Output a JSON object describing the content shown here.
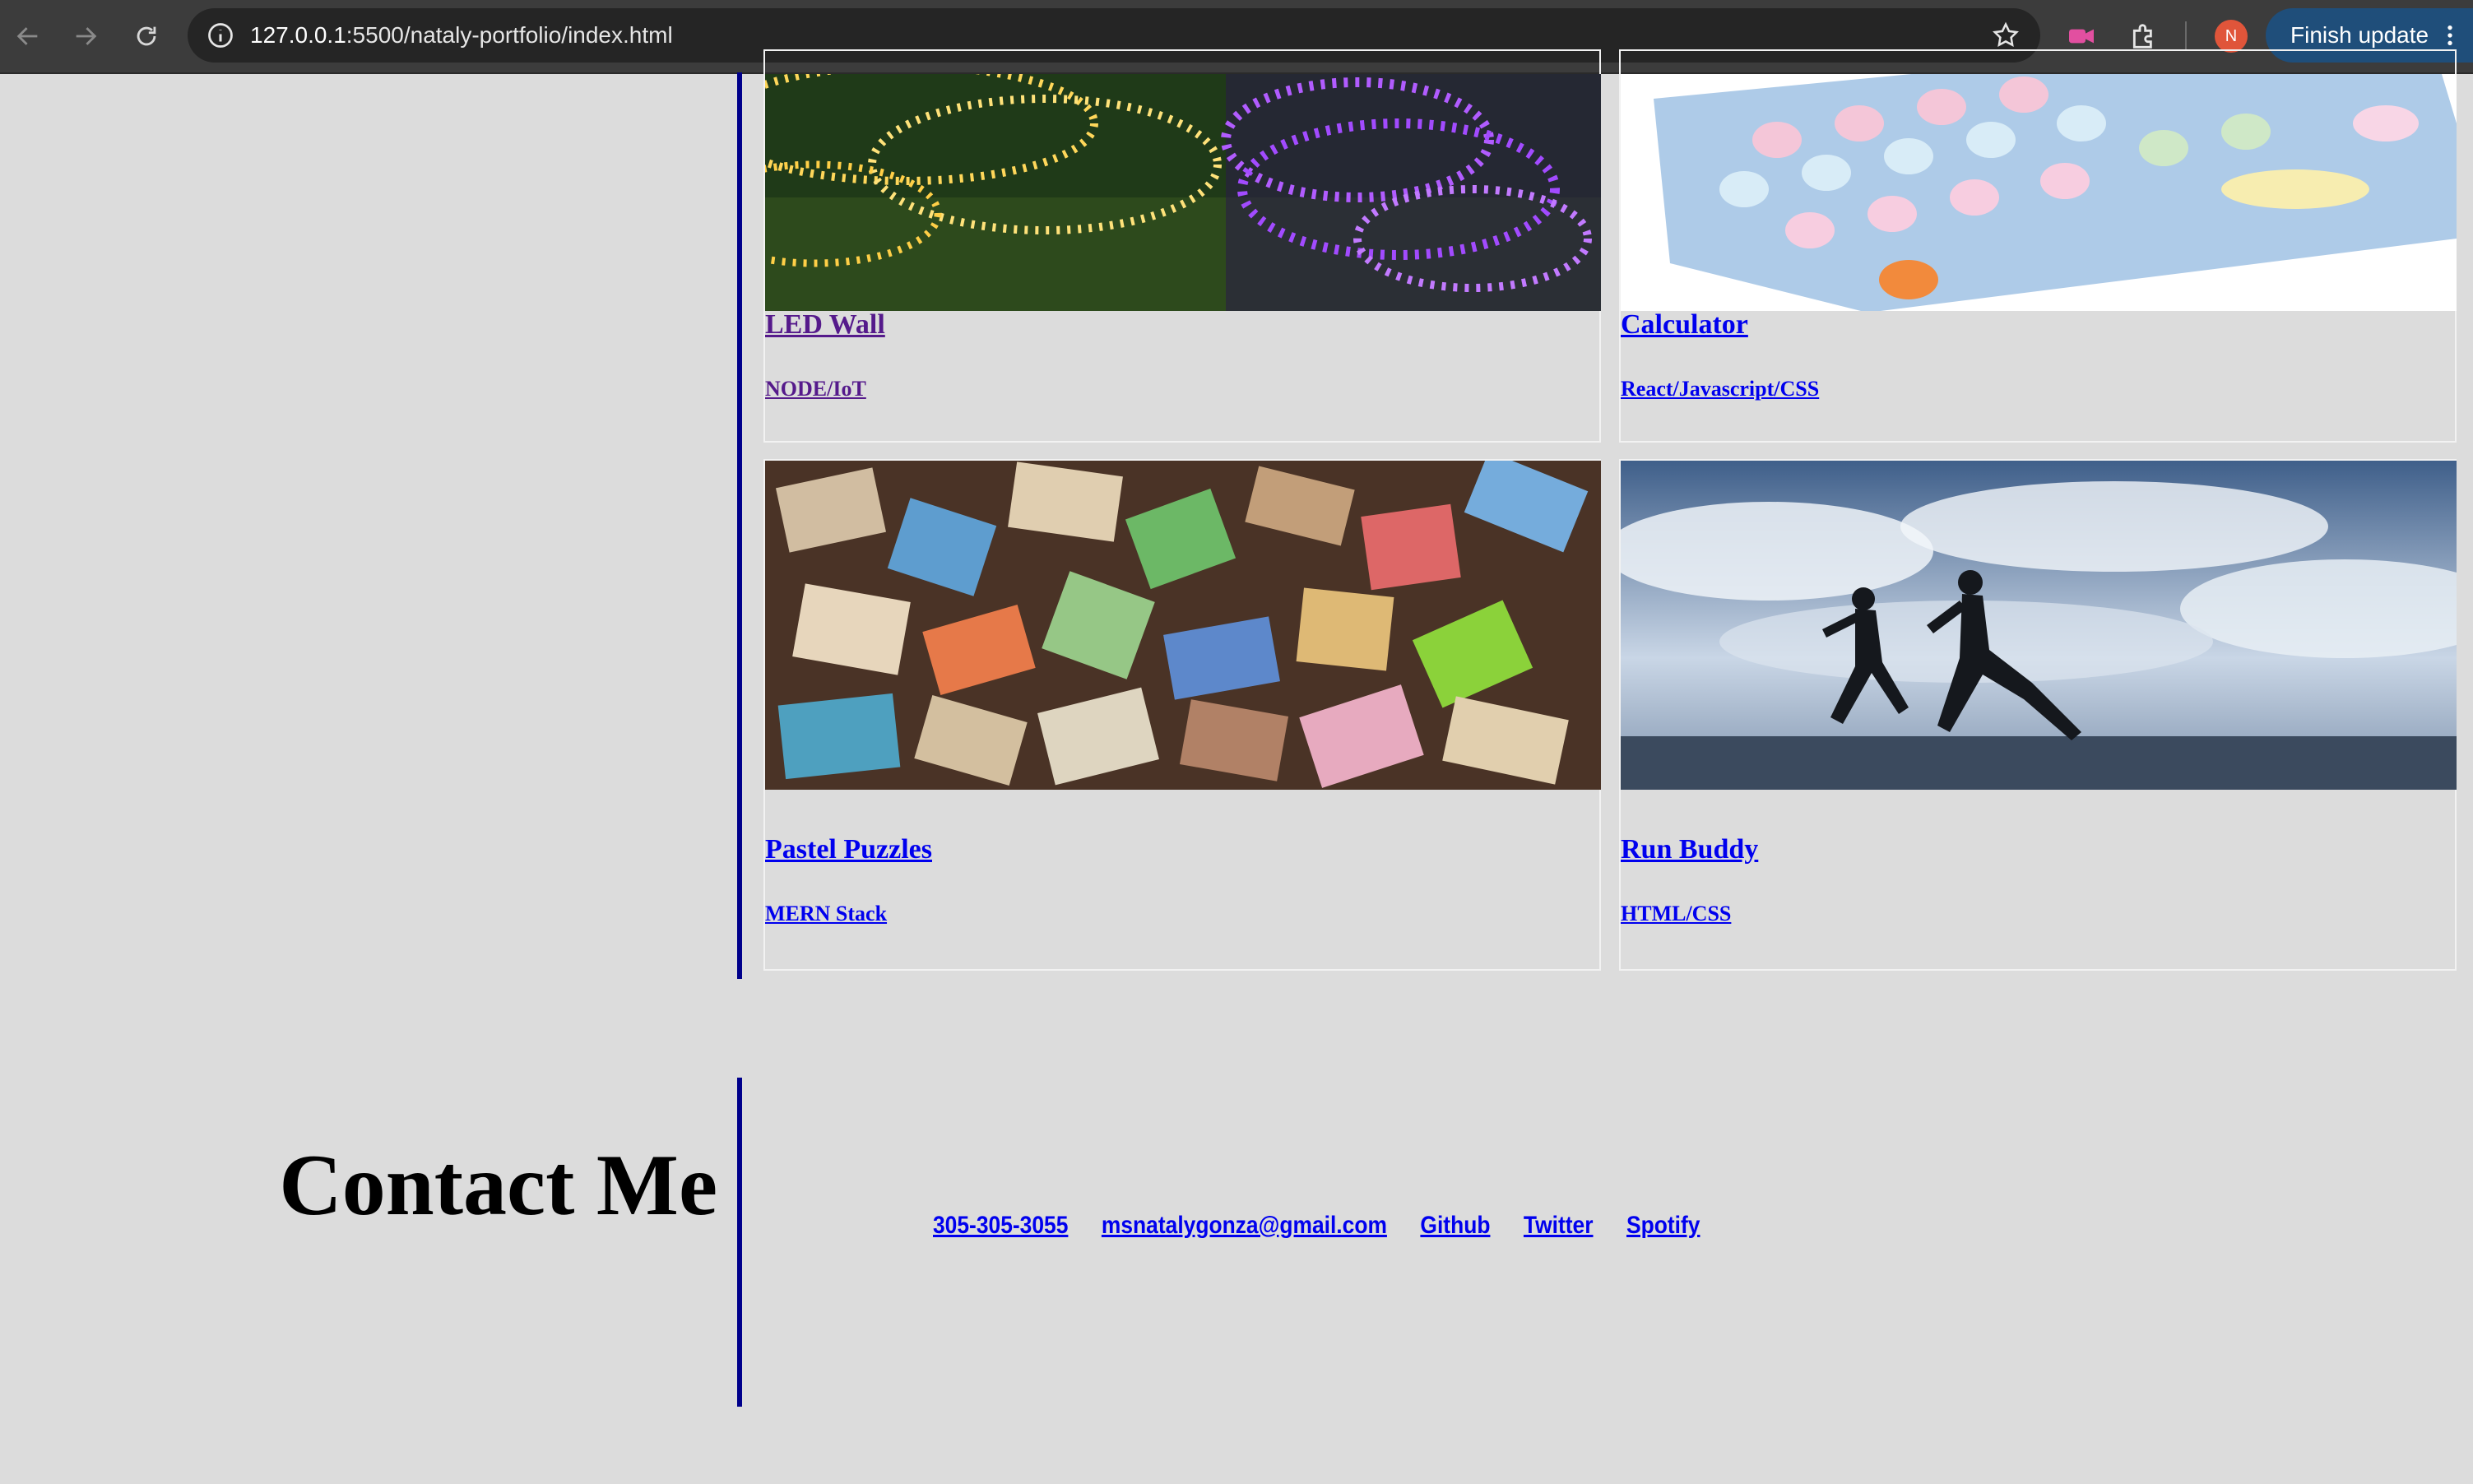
{
  "browser": {
    "url_host": "127.0.0.1",
    "url_rest": ":5500/nataly-portfolio/index.html",
    "update_label": "Finish update",
    "profile_initial": "N"
  },
  "projects": [
    {
      "title": "LED Wall",
      "tags": "NODE/IoT",
      "visited": true
    },
    {
      "title": "Calculator",
      "tags": "React/Javascript/CSS",
      "visited": false
    },
    {
      "title": "Pastel Puzzles",
      "tags": "MERN Stack",
      "visited": false
    },
    {
      "title": "Run Buddy",
      "tags": "HTML/CSS",
      "visited": false
    }
  ],
  "contact": {
    "heading": "Contact Me",
    "links": [
      "305-305-3055",
      "msnatalygonza@gmail.com",
      "Github",
      "Twitter",
      "Spotify"
    ]
  },
  "colors": {
    "background": "#dcdcdc",
    "accent_line": "#00008b",
    "link": "#0000ee",
    "visited_link": "#551a8b"
  },
  "icons": [
    "back-arrow-icon",
    "forward-arrow-icon",
    "reload-icon",
    "site-info-icon",
    "bookmark-star-icon",
    "extension-camera-icon",
    "puzzle-extensions-icon",
    "menu-dots-icon"
  ]
}
